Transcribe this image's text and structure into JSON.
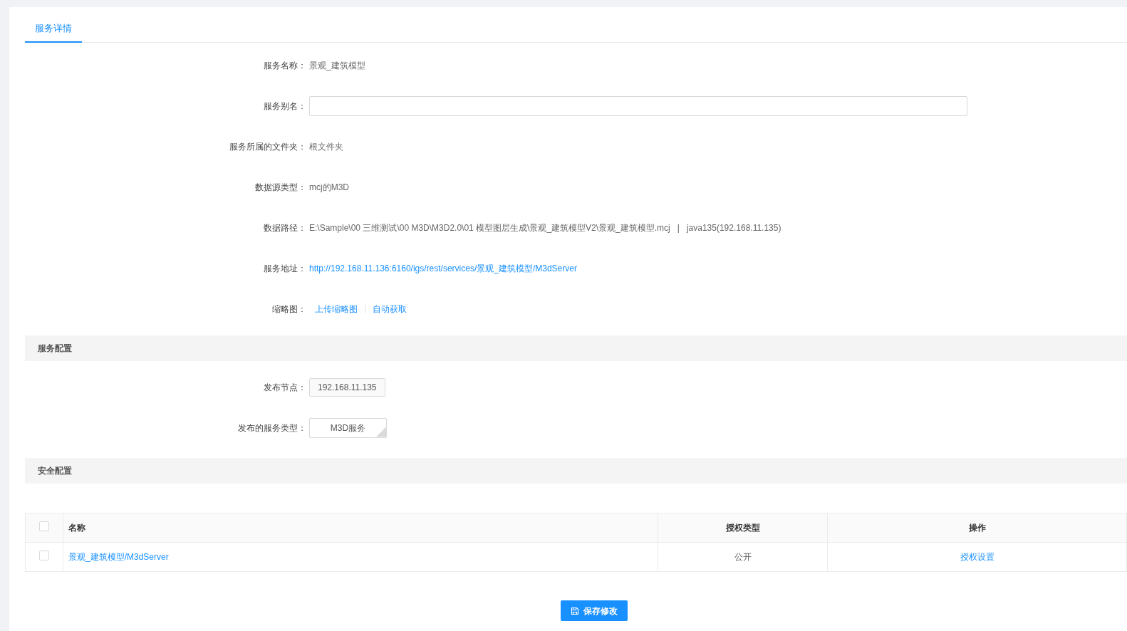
{
  "tabs": [
    {
      "label": "服务详情",
      "selected": true
    }
  ],
  "details": [
    {
      "kind": "text",
      "label": "服务名称：",
      "value": "景观_建筑模型"
    },
    {
      "kind": "input",
      "label": "服务别名："
    },
    {
      "kind": "text",
      "label": "服务所属的文件夹：",
      "value": "根文件夹"
    },
    {
      "kind": "text",
      "label": "数据源类型：",
      "value": "mcj的M3D"
    },
    {
      "kind": "text",
      "label": "数据路径：",
      "value": "E:\\Sample\\00 三维测试\\00 M3D\\M3D2.0\\01 模型图层生成\\景观_建筑模型V2\\景观_建筑模型.mcj   |   java135(192.168.11.135)"
    },
    {
      "kind": "link",
      "label": "服务地址：",
      "value": "http://192.168.11.136:6160/igs/rest/services/景观_建筑模型/M3dServer"
    },
    {
      "kind": "links",
      "label": "缩略图：",
      "links": [
        "上传缩略图",
        "自动获取"
      ]
    }
  ],
  "service_config": {
    "title": "服务配置",
    "fields": [
      {
        "kind": "box",
        "label": "发布节点：",
        "value": "192.168.11.135"
      },
      {
        "kind": "select",
        "label": "发布的服务类型：",
        "value": "M3D服务"
      }
    ]
  },
  "security_config": {
    "title": "安全配置"
  },
  "table": {
    "header_checked": false,
    "columns": [
      "名称",
      "授权类型",
      "操作"
    ],
    "rows": [
      {
        "checked": false,
        "name": "景观_建筑模型/M3dServer",
        "auth_type": "公开",
        "action": "授权设置"
      }
    ]
  },
  "save_button": "保存修改"
}
